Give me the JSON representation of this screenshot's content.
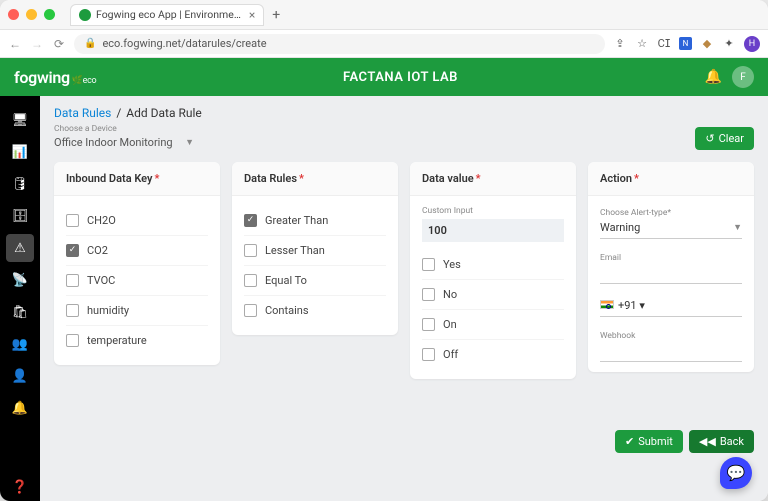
{
  "browser": {
    "tab_title": "Fogwing eco App | Environme…",
    "url": "eco.fogwing.net/datarules/create"
  },
  "header": {
    "logo_main": "fogwing",
    "logo_sub": "🌿eco",
    "title": "FACTANA IOT LAB",
    "user_initial": "F"
  },
  "sidebar": {
    "items": [
      "dashboard",
      "analytics",
      "devices",
      "data",
      "alerts",
      "signal",
      "org",
      "team",
      "account",
      "notify"
    ],
    "active_index": 4,
    "help": "help"
  },
  "breadcrumb": {
    "parent": "Data Rules",
    "sep": "/",
    "current": "Add Data Rule"
  },
  "device": {
    "label": "Choose a Device",
    "value": "Office Indoor Monitoring"
  },
  "buttons": {
    "clear": "Clear",
    "submit": "Submit",
    "back": "Back"
  },
  "cards": {
    "inbound": {
      "title": "Inbound Data Key",
      "options": [
        {
          "label": "CH2O",
          "checked": false
        },
        {
          "label": "CO2",
          "checked": true
        },
        {
          "label": "TVOC",
          "checked": false
        },
        {
          "label": "humidity",
          "checked": false
        },
        {
          "label": "temperature",
          "checked": false
        }
      ]
    },
    "rules": {
      "title": "Data Rules",
      "options": [
        {
          "label": "Greater Than",
          "checked": true
        },
        {
          "label": "Lesser Than",
          "checked": false
        },
        {
          "label": "Equal To",
          "checked": false
        },
        {
          "label": "Contains",
          "checked": false
        }
      ]
    },
    "value": {
      "title": "Data value",
      "custom_label": "Custom Input",
      "custom_value": "100",
      "options": [
        {
          "label": "Yes",
          "checked": false
        },
        {
          "label": "No",
          "checked": false
        },
        {
          "label": "On",
          "checked": false
        },
        {
          "label": "Off",
          "checked": false
        }
      ]
    },
    "action": {
      "title": "Action",
      "alert_label": "Choose Alert-type*",
      "alert_value": "Warning",
      "email_label": "Email",
      "email_value": "",
      "phone_code": "+91",
      "phone_value": "",
      "webhook_label": "Webhook",
      "webhook_value": ""
    }
  }
}
